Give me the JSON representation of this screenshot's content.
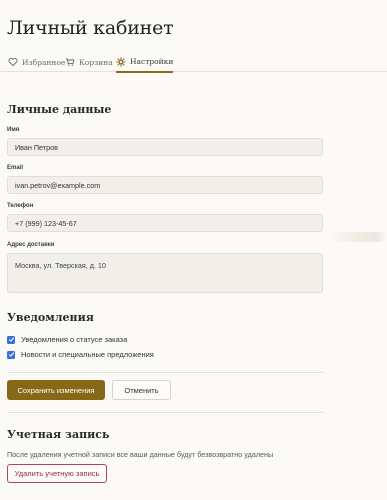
{
  "page": {
    "title": "Личный кабинет"
  },
  "tabs": [
    {
      "label": "Избранное",
      "icon": "heart-icon",
      "active": false
    },
    {
      "label": "Корзина",
      "icon": "cart-icon",
      "active": false
    },
    {
      "label": "Настройки",
      "icon": "gear-icon",
      "active": true
    }
  ],
  "personal": {
    "heading": "Личные данные",
    "name_label": "Имя",
    "name_value": "Иван Петров",
    "email_label": "Email",
    "email_value": "ivan.petrov@example.com",
    "phone_label": "Телефон",
    "phone_value": "+7 (999) 123-45-67",
    "address_label": "Адрес доставки",
    "address_value": "Москва, ул. Тверская, д. 10"
  },
  "notifications": {
    "heading": "Уведомления",
    "items": [
      {
        "label": "Уведомления о статусе заказа",
        "checked": true
      },
      {
        "label": "Новости и специальные предложения",
        "checked": true
      }
    ]
  },
  "actions": {
    "save_label": "Сохранить изменения",
    "cancel_label": "Отменить"
  },
  "account": {
    "heading": "Учетная запись",
    "warning": "После удаления учетной записи все ваши данные будут безвозвратно удалены",
    "delete_label": "Удалить учетную запись"
  },
  "colors": {
    "accent": "#876816",
    "danger": "#b54658",
    "checkbox": "#3c6fd8",
    "background": "#fbfaf7"
  }
}
